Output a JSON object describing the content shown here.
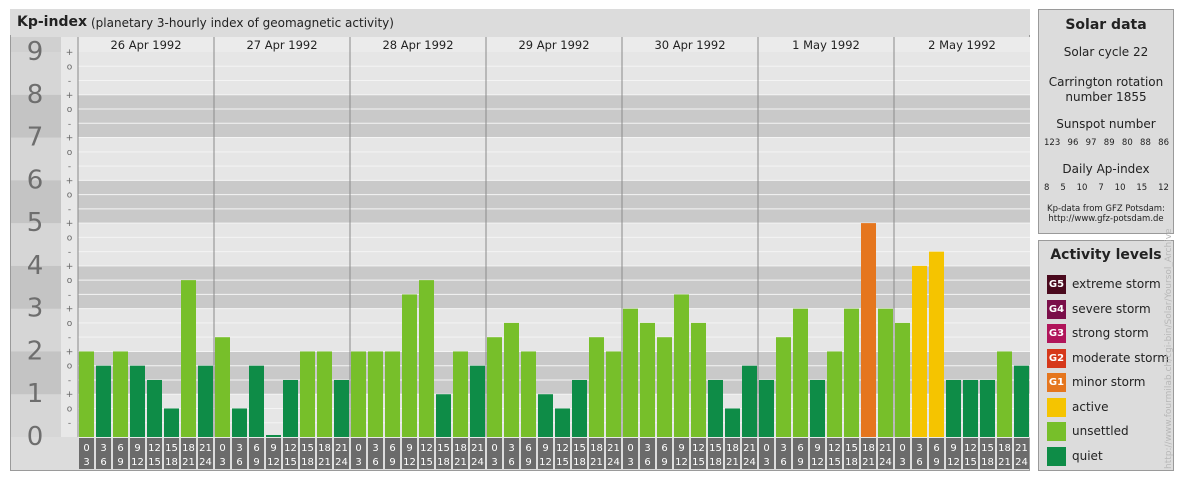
{
  "header": {
    "title": "Kp-index",
    "subtitle": "(planetary 3-hourly index of geomagnetic activity)"
  },
  "chart_data": {
    "type": "bar",
    "title": "Kp-index",
    "subtitle": "(planetary 3-hourly index of geomagnetic activity)",
    "ylim": [
      0,
      9
    ],
    "y_major_ticks": [
      "0",
      "1",
      "2",
      "3",
      "4",
      "5",
      "6",
      "7",
      "8",
      "9"
    ],
    "y_minor_ticks": [
      "-",
      "o",
      "+"
    ],
    "days": [
      "26 Apr 1992",
      "27 Apr 1992",
      "28 Apr 1992",
      "29 Apr 1992",
      "30 Apr 1992",
      "1 May 1992",
      "2 May 1992"
    ],
    "interval_labels": [
      [
        "0",
        "3"
      ],
      [
        "3",
        "6"
      ],
      [
        "6",
        "9"
      ],
      [
        "9",
        "12"
      ],
      [
        "12",
        "15"
      ],
      [
        "15",
        "18"
      ],
      [
        "18",
        "21"
      ],
      [
        "21",
        "24"
      ]
    ],
    "values": [
      [
        2.0,
        1.667,
        2.0,
        1.667,
        1.333,
        0.667,
        3.667,
        1.667
      ],
      [
        2.333,
        0.667,
        1.667,
        0.0,
        1.333,
        2.0,
        2.0,
        1.333
      ],
      [
        2.0,
        2.0,
        2.0,
        3.333,
        3.667,
        1.0,
        2.0,
        1.667
      ],
      [
        2.333,
        2.667,
        2.0,
        1.0,
        0.667,
        1.333,
        2.333,
        2.0
      ],
      [
        3.0,
        2.667,
        2.333,
        3.333,
        2.667,
        1.333,
        0.667,
        1.667
      ],
      [
        1.333,
        2.333,
        3.0,
        1.333,
        2.0,
        3.0,
        5.0,
        3.0
      ],
      [
        2.667,
        4.0,
        4.333,
        1.333,
        1.333,
        1.333,
        2.0,
        1.667
      ]
    ]
  },
  "solar": {
    "title": "Solar data",
    "cycle": "Solar cycle 22",
    "carrington_1": "Carrington rotation",
    "carrington_2": "number 1855",
    "sunspot_title": "Sunspot number",
    "sunspot": [
      "123",
      "96",
      "97",
      "89",
      "80",
      "88",
      "86"
    ],
    "ap_title": "Daily Ap-index",
    "ap": [
      "8",
      "5",
      "10",
      "7",
      "10",
      "15",
      "12"
    ],
    "source_1": "Kp-data from GFZ Potsdam:",
    "source_2": "http://www.gfz-potsdam.de"
  },
  "activity": {
    "title": "Activity levels",
    "levels": [
      {
        "code": "G5",
        "label": "extreme storm",
        "color": "#4a0a1e"
      },
      {
        "code": "G4",
        "label": "severe storm",
        "color": "#7a0f4a"
      },
      {
        "code": "G3",
        "label": "strong storm",
        "color": "#b0155a"
      },
      {
        "code": "G2",
        "label": "moderate storm",
        "color": "#d6381a"
      },
      {
        "code": "G1",
        "label": "minor storm",
        "color": "#e5761e"
      },
      {
        "code": "",
        "label": "active",
        "color": "#f5c400"
      },
      {
        "code": "",
        "label": "unsettled",
        "color": "#77bf2a"
      },
      {
        "code": "",
        "label": "quiet",
        "color": "#0e8c47"
      }
    ]
  },
  "watermark": "http://www.fourmilab.ch/cgi-bin/Solar/Yoursol_Archive"
}
